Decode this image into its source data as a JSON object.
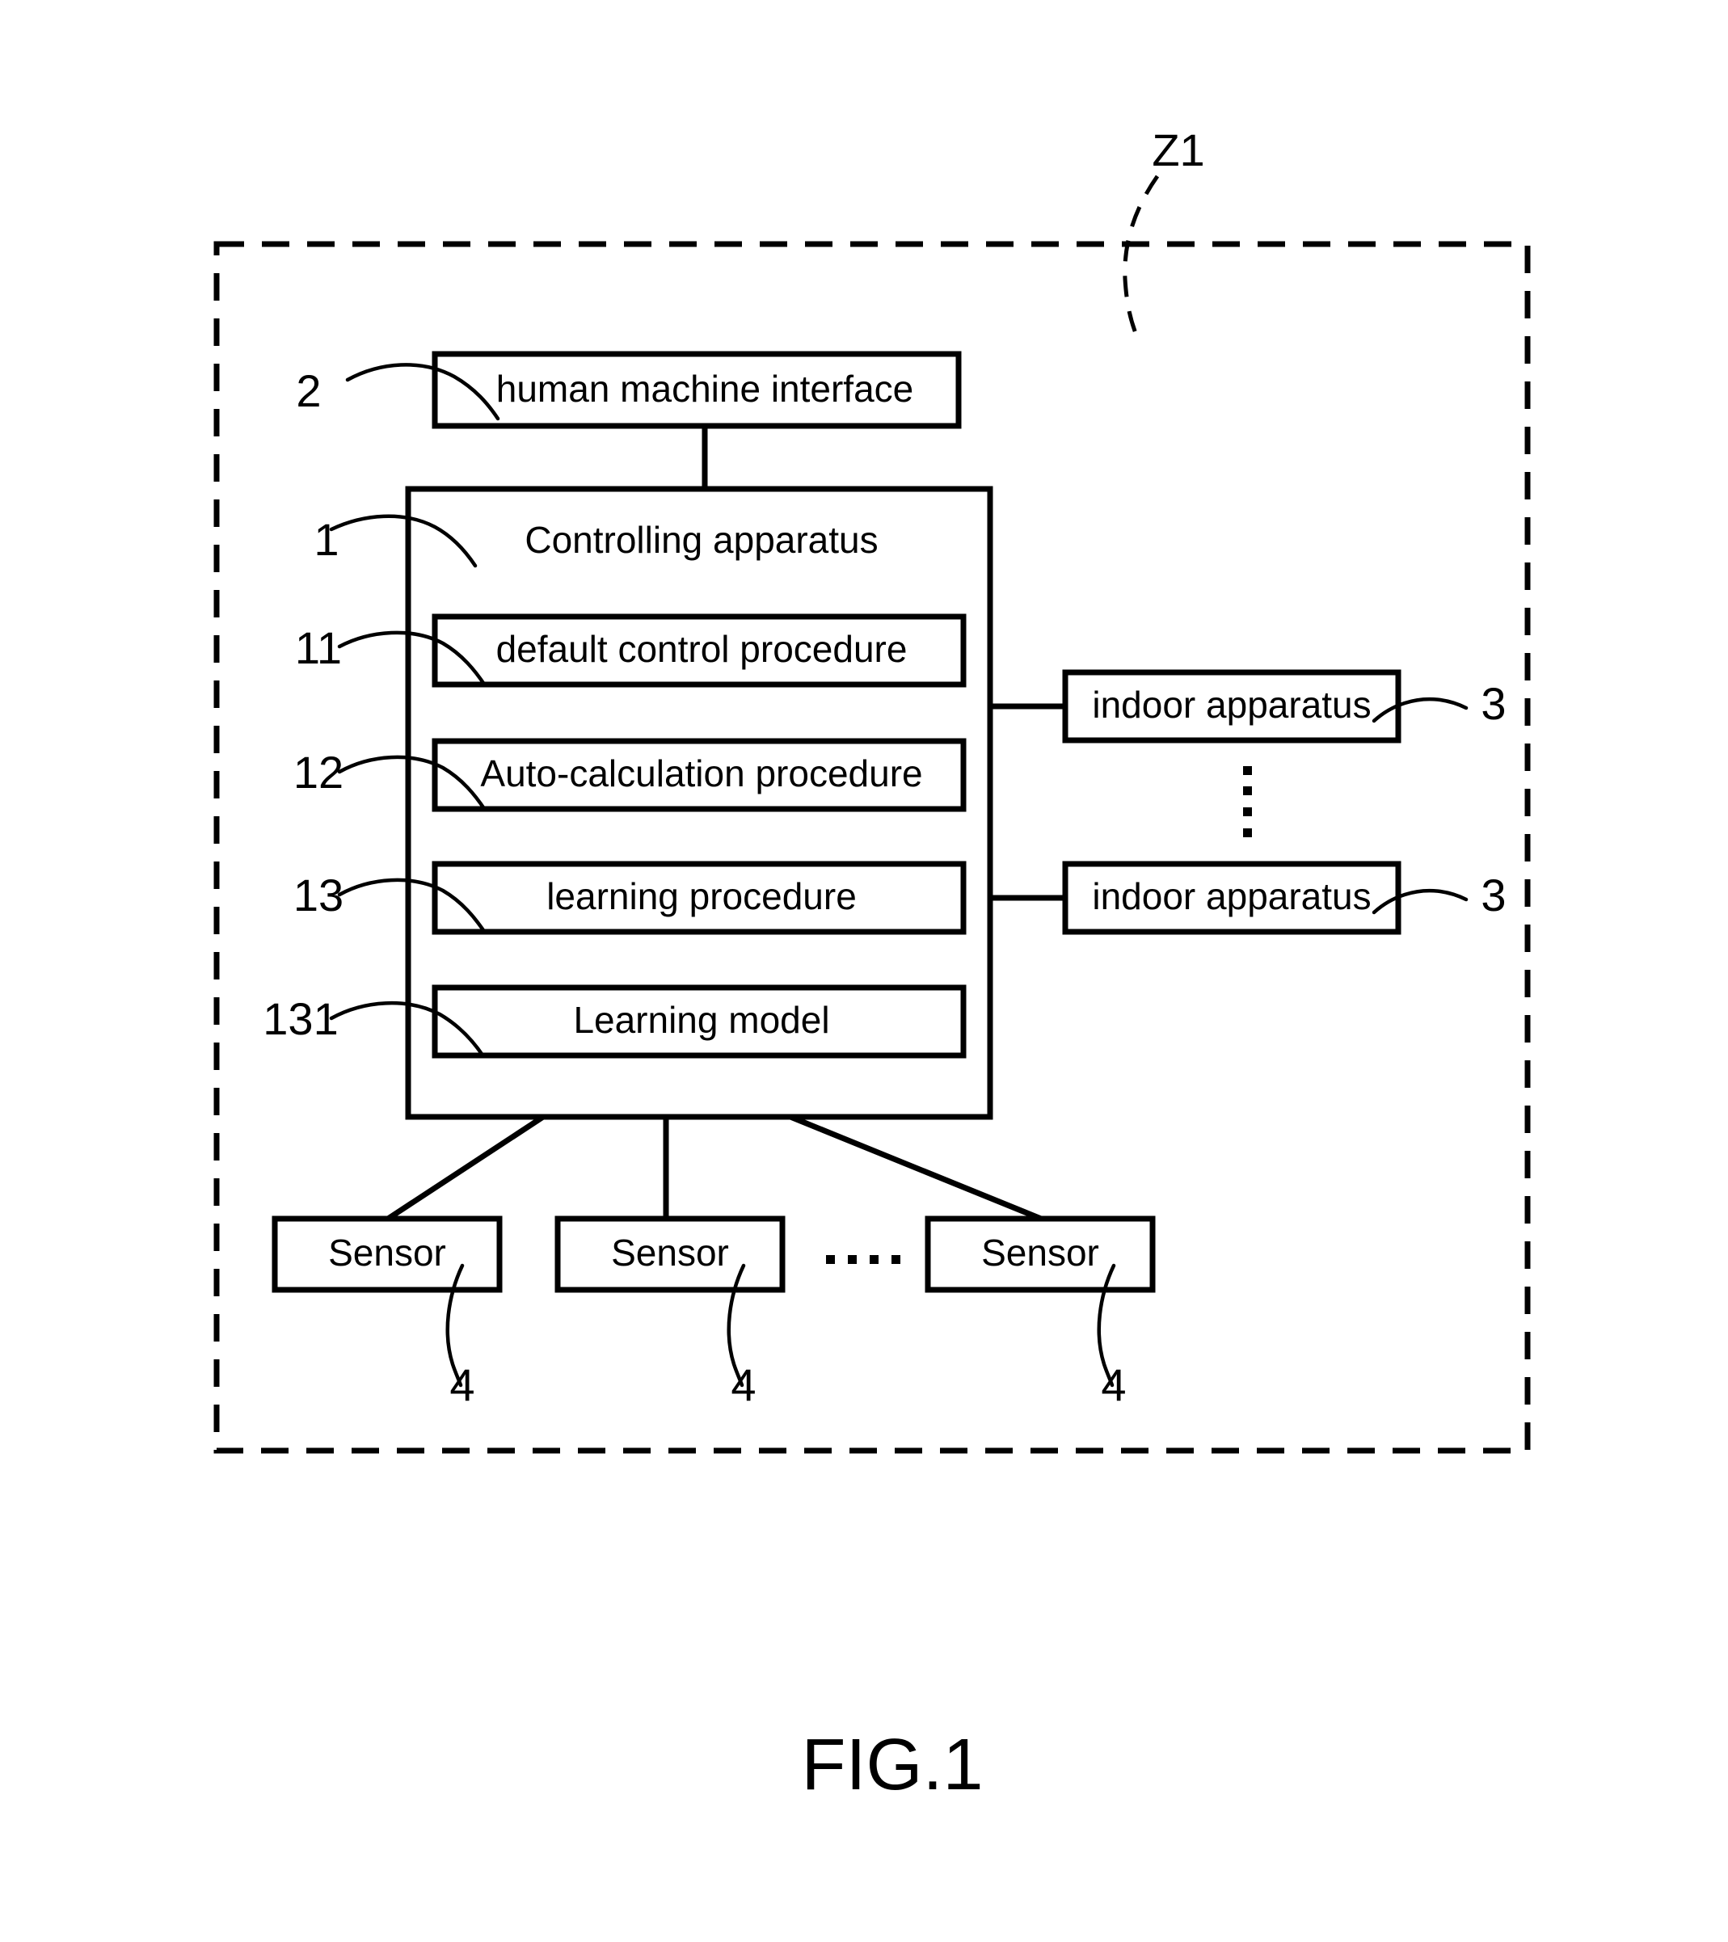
{
  "figure": {
    "caption": "FIG.1",
    "system_boundary_label": "Z1"
  },
  "blocks": {
    "human_machine_interface": {
      "label": "human machine interface",
      "ref": "2"
    },
    "controlling_apparatus": {
      "label": "Controlling apparatus",
      "ref": "1"
    },
    "default_control_procedure": {
      "label": "default control procedure",
      "ref": "11"
    },
    "auto_calculation_procedure": {
      "label": "Auto-calculation procedure",
      "ref": "12"
    },
    "learning_procedure": {
      "label": "learning procedure",
      "ref": "13"
    },
    "learning_model": {
      "label": "Learning model",
      "ref": "131"
    }
  },
  "indoor_apparatuses": [
    {
      "label": "indoor apparatus",
      "ref": "3"
    },
    {
      "label": "indoor apparatus",
      "ref": "3"
    }
  ],
  "sensors": [
    {
      "label": "Sensor",
      "ref": "4"
    },
    {
      "label": "Sensor",
      "ref": "4"
    },
    {
      "label": "Sensor",
      "ref": "4"
    }
  ],
  "ellipses": {
    "vertical_between_indoor_apparatus": "⋮",
    "horizontal_between_sensors": "⋯"
  },
  "colors": {
    "stroke": "#000000",
    "fill": "#ffffff",
    "text": "#000000"
  }
}
